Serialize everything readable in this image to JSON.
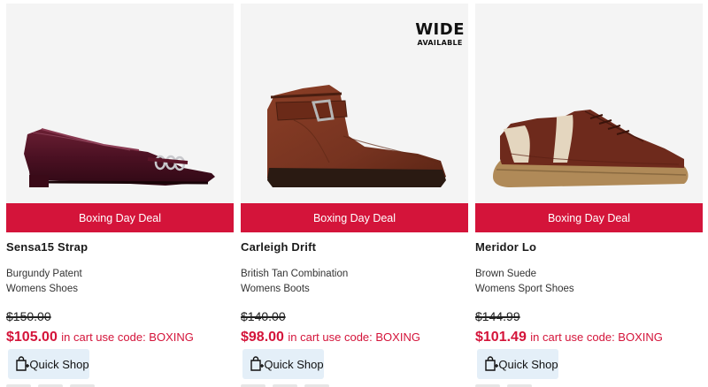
{
  "products": [
    {
      "name": "Sensa15 Strap",
      "color": "Burgundy Patent",
      "category": "Womens Shoes",
      "original_price": "$150.00",
      "sale_price": "$105.00",
      "promo_text": "in cart use code: BOXING",
      "deal_label": "Boxing Day Deal",
      "badge_line1": "",
      "badge_line2": "",
      "quick_shop_label": "Quick Shop",
      "image_icon": "burgundy-patent-flat-icon"
    },
    {
      "name": "Carleigh Drift",
      "color": "British Tan Combination",
      "category": "Womens Boots",
      "original_price": "$140.00",
      "sale_price": "$98.00",
      "promo_text": "in cart use code: BOXING",
      "deal_label": "Boxing Day Deal",
      "badge_line1": "WIDE",
      "badge_line2": "AVAILABLE",
      "quick_shop_label": "Quick Shop",
      "image_icon": "tan-ankle-boot-icon"
    },
    {
      "name": "Meridor Lo",
      "color": "Brown Suede",
      "category": "Womens Sport Shoes",
      "original_price": "$144.99",
      "sale_price": "$101.49",
      "promo_text": "in cart use code: BOXING",
      "deal_label": "Boxing Day Deal",
      "badge_line1": "",
      "badge_line2": "",
      "quick_shop_label": "Quick Shop",
      "image_icon": "brown-suede-sneaker-icon"
    }
  ],
  "colors": {
    "deal_banner": "#d4143a",
    "sale_price": "#d4143a",
    "quick_shop_bg": "#e4eff8",
    "image_bg": "#f4f4f4"
  }
}
